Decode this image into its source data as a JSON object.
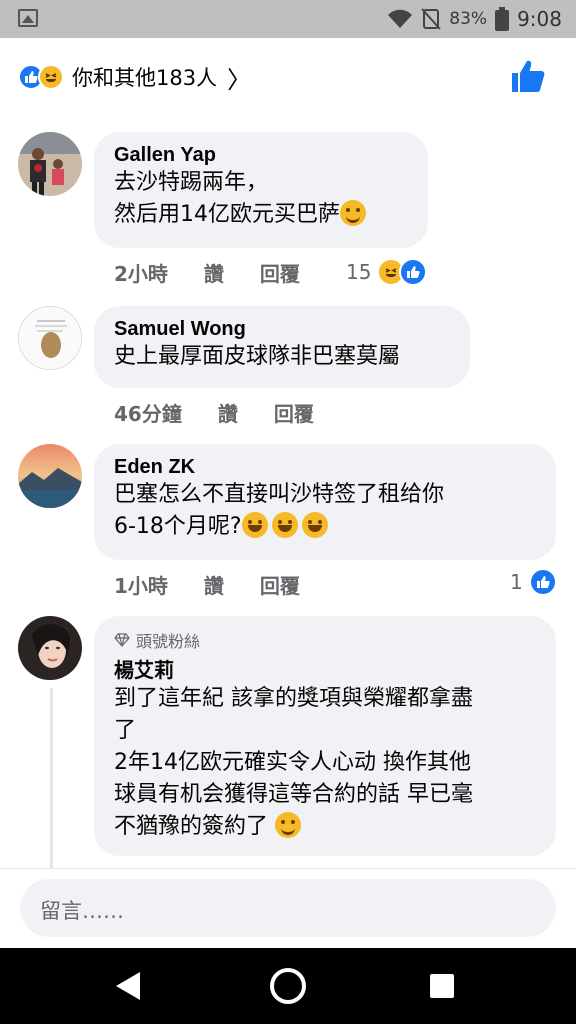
{
  "status_bar": {
    "battery": "83%",
    "time": "9:08"
  },
  "header": {
    "summary": "你和其他183人",
    "chevron": "〉"
  },
  "comments": [
    {
      "author": "Gallen Yap",
      "text": "去沙特踢兩年，\n然后用14亿欧元买巴萨",
      "emoji": "smile",
      "time": "2小時",
      "like_label": "讚",
      "reply_label": "回覆",
      "reaction_count": "15"
    },
    {
      "author": "Samuel Wong",
      "text": "史上最厚面皮球隊非巴塞莫屬",
      "time": "46分鐘",
      "like_label": "讚",
      "reply_label": "回覆"
    },
    {
      "author": "Eden ZK",
      "text": "巴塞怎么不直接叫沙特签了租给你\n6-18个月呢?",
      "emoji": "laugh x3",
      "time": "1小時",
      "like_label": "讚",
      "reply_label": "回覆",
      "reaction_count": "1"
    },
    {
      "badge": "頭號粉絲",
      "author": "楊艾莉",
      "text": "到了這年紀 該拿的獎項與榮耀都拿盡\n了\n2年14亿欧元確实令人心动 換作其他\n球員有机会獲得這等合約的話 早已毫\n不猶豫的簽約了",
      "emoji": "sweat-smile"
    }
  ],
  "composer": {
    "placeholder": "留言……"
  },
  "colors": {
    "like_blue": "#1877f2",
    "haha_yellow": "#f7b928",
    "bubble_gray": "#f0f2f5",
    "meta_gray": "#65676b"
  }
}
